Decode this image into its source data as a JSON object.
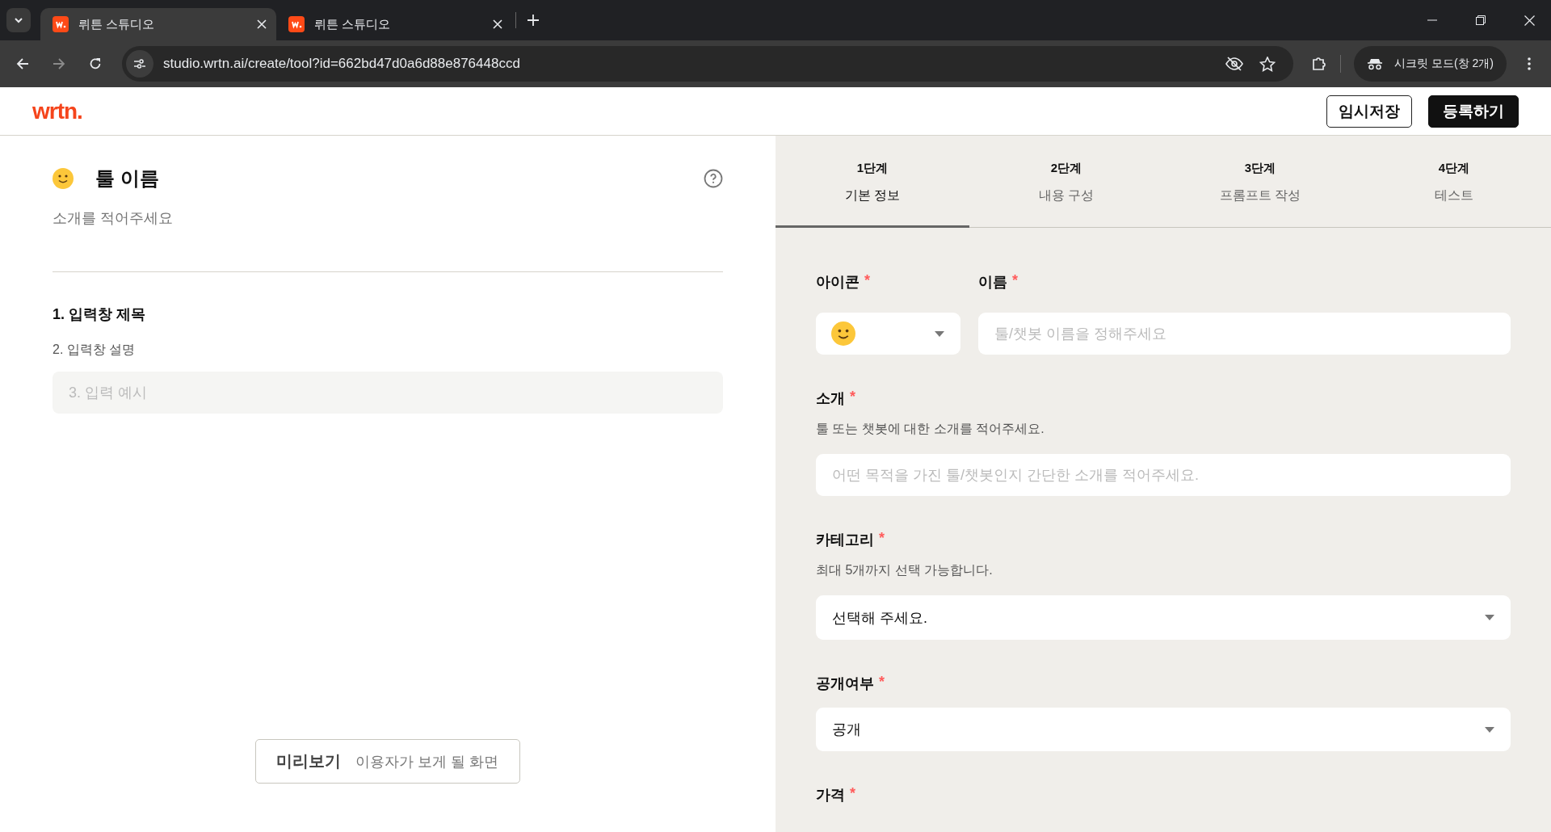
{
  "browser": {
    "tabs": [
      {
        "title": "뤼튼 스튜디오",
        "selected": true
      },
      {
        "title": "뤼튼 스튜디오",
        "selected": false
      }
    ],
    "url": "studio.wrtn.ai/create/tool?id=662bd47d0a6d88e876448ccd",
    "profile": "시크릿 모드(창 2개)"
  },
  "header": {
    "logo": "wrtn.",
    "buttons": [
      {
        "label": "임시저장",
        "kind": "outline"
      },
      {
        "label": "등록하기",
        "kind": "primary"
      }
    ]
  },
  "preview": {
    "title": "툴 이름",
    "intro": "소개를 적어주세요",
    "input_title": "1. 입력창 제목",
    "input_description": "2. 입력창 설명",
    "input_placeholder": "3. 입력 예시",
    "button": {
      "label": "미리보기",
      "sub": "이용자가 보게 될 화면"
    }
  },
  "steps": [
    {
      "step": "1단계",
      "label": "기본 정보",
      "selected": true
    },
    {
      "step": "2단계",
      "label": "내용 구성",
      "selected": false
    },
    {
      "step": "3단계",
      "label": "프롬프트 작성",
      "selected": false
    },
    {
      "step": "4단계",
      "label": "테스트",
      "selected": false
    }
  ],
  "form": {
    "top_row": [
      {
        "kind": "icon_select",
        "label": "아이콘",
        "required_mark": "*"
      },
      {
        "kind": "text",
        "label": "이름",
        "required_mark": "*",
        "placeholder": "툴/챗봇 이름을 정해주세요"
      }
    ],
    "fields": [
      {
        "kind": "text",
        "label": "소개",
        "required_mark": "*",
        "help": "툴 또는 챗봇에 대한 소개를 적어주세요.",
        "placeholder": "어떤 목적을 가진 툴/챗봇인지 간단한 소개를 적어주세요."
      },
      {
        "kind": "select",
        "label": "카테고리",
        "required_mark": "*",
        "help": "최대 5개까지 선택 가능합니다.",
        "value": "선택해 주세요."
      },
      {
        "kind": "select",
        "label": "공개여부",
        "required_mark": "*",
        "value": "공개"
      },
      {
        "kind": "label",
        "label": "가격",
        "required_mark": "*"
      }
    ]
  }
}
